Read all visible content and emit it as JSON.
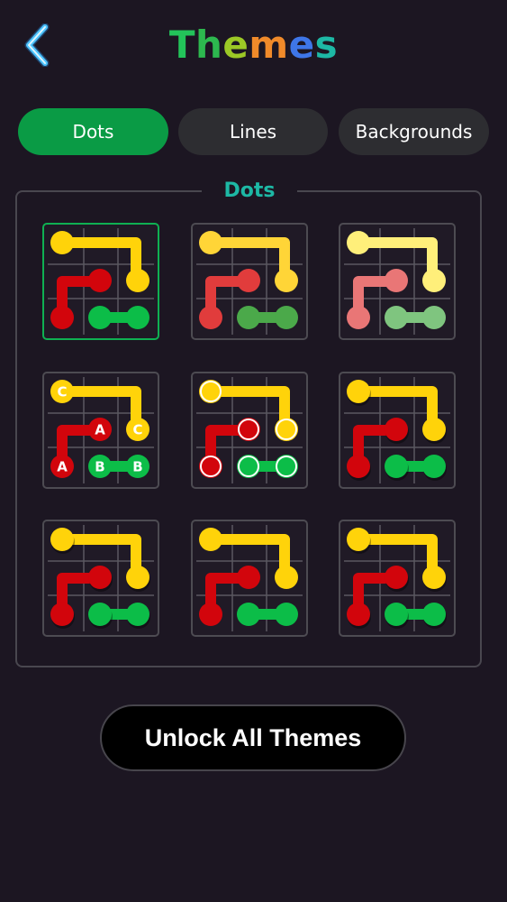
{
  "header": {
    "back_icon": "chevron-left-icon",
    "title_letters": [
      {
        "char": "T",
        "color": "#23c35a"
      },
      {
        "char": "h",
        "color": "#2db84f"
      },
      {
        "char": "e",
        "color": "#9cc826"
      },
      {
        "char": "m",
        "color": "#f08a2a"
      },
      {
        "char": "e",
        "color": "#3e76e8"
      },
      {
        "char": "s",
        "color": "#1db8a5"
      }
    ]
  },
  "tabs": [
    {
      "label": "Dots",
      "active": true
    },
    {
      "label": "Lines",
      "active": false
    },
    {
      "label": "Backgrounds",
      "active": false
    }
  ],
  "section": {
    "title": "Dots"
  },
  "themes": [
    {
      "selected": true,
      "variant": "plain",
      "yellow": "#ffd30a",
      "red": "#d2050c",
      "green": "#0cbd48"
    },
    {
      "selected": false,
      "variant": "plain",
      "yellow": "#ffd537",
      "red": "#e13c3c",
      "green": "#4ba94a"
    },
    {
      "selected": false,
      "variant": "plain",
      "yellow": "#ffef7a",
      "red": "#e97676",
      "green": "#7fc57f"
    },
    {
      "selected": false,
      "variant": "letters",
      "yellow": "#ffd30a",
      "red": "#d2050c",
      "green": "#0cbd48",
      "letters": {
        "yellow": "C",
        "red": "A",
        "green": "B"
      }
    },
    {
      "selected": false,
      "variant": "ring",
      "yellow": "#ffd30a",
      "red": "#d2050c",
      "green": "#0cbd48"
    },
    {
      "selected": false,
      "variant": "shadow",
      "yellow": "#ffd30a",
      "red": "#d2050c",
      "green": "#0cbd48"
    },
    {
      "selected": false,
      "variant": "shadow",
      "yellow": "#ffd30a",
      "red": "#d2050c",
      "green": "#0cbd48"
    },
    {
      "selected": false,
      "variant": "plain",
      "yellow": "#ffd30a",
      "red": "#d2050c",
      "green": "#0cbd48"
    },
    {
      "selected": false,
      "variant": "shadow",
      "yellow": "#ffd30a",
      "red": "#d2050c",
      "green": "#0cbd48"
    }
  ],
  "colors": {
    "background": "#1c1622",
    "tab_active": "#0a9b45",
    "tab_inactive": "#2d2d31",
    "section_title": "#1db8a5",
    "back_icon": "#4cc4ff"
  },
  "unlock": {
    "label": "Unlock All Themes"
  }
}
